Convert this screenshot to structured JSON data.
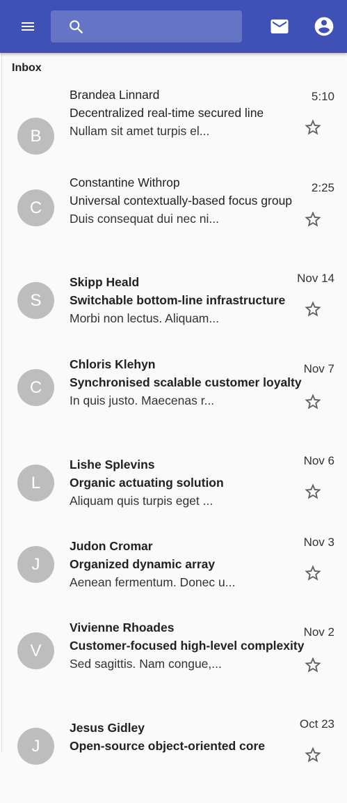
{
  "appbar": {
    "menu_icon": "menu-icon",
    "search_icon": "search-icon",
    "search_placeholder": "",
    "mail_icon": "mail-icon",
    "account_icon": "account-circle-icon",
    "color": "#3f51b5"
  },
  "inbox": {
    "label": "Inbox",
    "messages": [
      {
        "initial": "B",
        "sender": "Brandea Linnard",
        "subject": "Decentralized real-time secured line",
        "preview": "Nullam sit amet turpis el...",
        "time": "5:10",
        "unread": false
      },
      {
        "initial": "C",
        "sender": "Constantine Withrop",
        "subject": "Universal contextually-based focus group",
        "preview": "Duis consequat dui nec ni...",
        "time": "2:25",
        "unread": false
      },
      {
        "initial": "S",
        "sender": "Skipp Heald",
        "subject": "Switchable bottom-line infrastructure",
        "preview": "Morbi non lectus. Aliquam...",
        "time": "Nov 14",
        "unread": true
      },
      {
        "initial": "C",
        "sender": "Chloris Klehyn",
        "subject": "Synchronised scalable customer loyalty",
        "preview": "In quis justo. Maecenas r...",
        "time": "Nov 7",
        "unread": true
      },
      {
        "initial": "L",
        "sender": "Lishe Splevins",
        "subject": "Organic actuating solution",
        "preview": "Aliquam quis turpis eget ...",
        "time": "Nov 6",
        "unread": true
      },
      {
        "initial": "J",
        "sender": "Judon Cromar",
        "subject": "Organized dynamic array",
        "preview": "Aenean fermentum. Donec u...",
        "time": "Nov 3",
        "unread": true
      },
      {
        "initial": "V",
        "sender": "Vivienne Rhoades",
        "subject": "Customer-focused high-level complexity",
        "preview": "Sed sagittis. Nam congue,...",
        "time": "Nov 2",
        "unread": true
      },
      {
        "initial": "J",
        "sender": "Jesus Gidley",
        "subject": "Open-source object-oriented core",
        "preview": "",
        "time": "Oct 23",
        "unread": true
      }
    ]
  }
}
